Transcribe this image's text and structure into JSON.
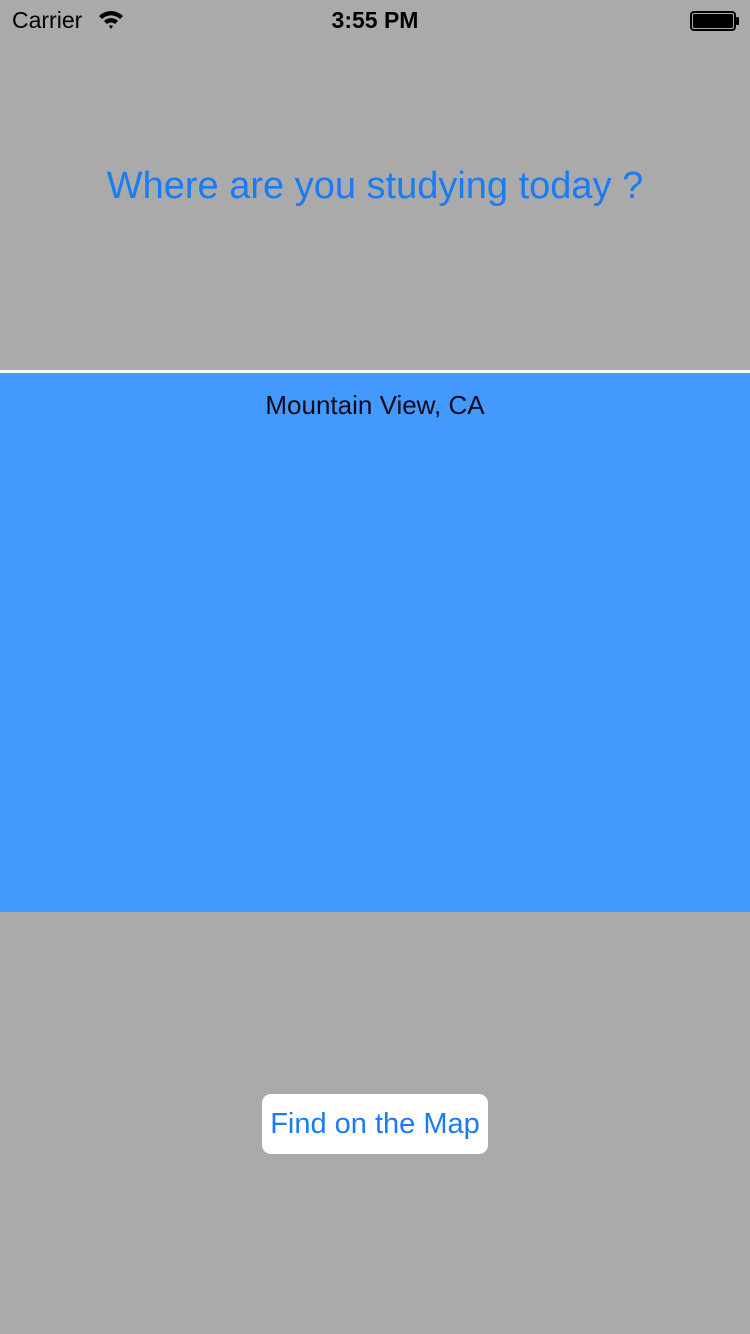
{
  "status_bar": {
    "carrier": "Carrier",
    "time": "3:55 PM",
    "wifi_icon": "wifi-icon",
    "battery_icon": "battery-icon"
  },
  "main": {
    "prompt": "Where are you studying today ?",
    "location_value": "Mountain View, CA",
    "find_button_label": "Find on the Map"
  },
  "colors": {
    "background": "#aaaaaa",
    "accent": "#1a7cf5",
    "location_panel": "#4499ff",
    "divider": "#ffffff",
    "button_background": "#ffffff"
  }
}
